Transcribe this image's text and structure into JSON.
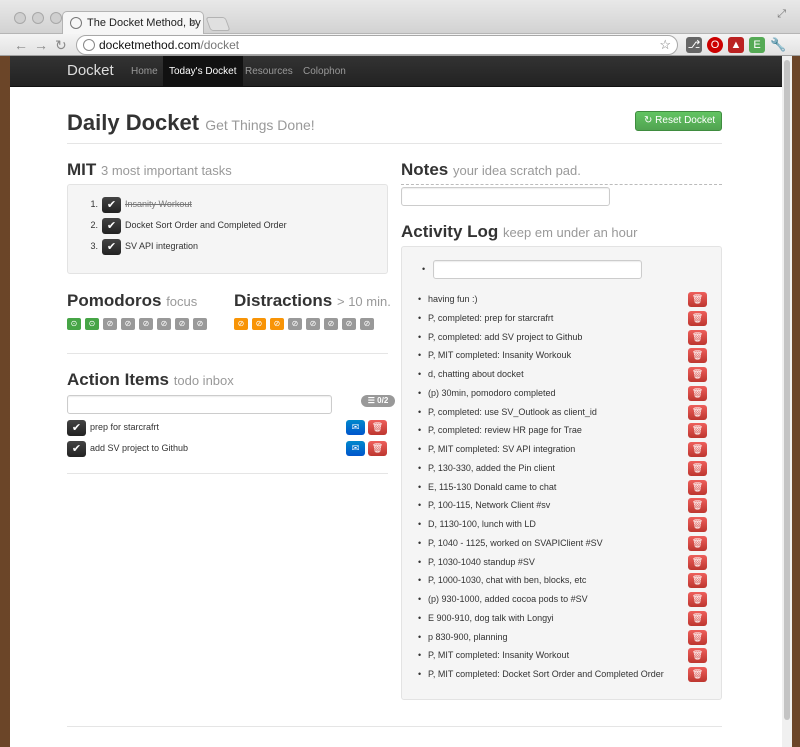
{
  "browser": {
    "tab_title": "The Docket Method, by Qtel",
    "url_host": "docketmethod.com",
    "url_path": "/docket"
  },
  "navbar": {
    "brand": "Docket",
    "links": [
      "Home",
      "Today's Docket",
      "Resources",
      "Colophon"
    ],
    "active_index": 1
  },
  "header": {
    "title": "Daily Docket",
    "subtitle": "Get Things Done!",
    "reset_button": "Reset Docket"
  },
  "mit": {
    "title": "MIT",
    "subtitle": "3 most important tasks",
    "items": [
      {
        "num": "1.",
        "label": "Insanity Workout",
        "done": true
      },
      {
        "num": "2.",
        "label": "Docket Sort Order and Completed Order",
        "done": false
      },
      {
        "num": "3.",
        "label": "SV API integration",
        "done": false
      }
    ]
  },
  "pomodoros": {
    "title": "Pomodoros",
    "subtitle": "focus",
    "total": 8,
    "completed": 2
  },
  "distractions": {
    "title": "Distractions",
    "subtitle": "> 10 min.",
    "total": 8,
    "completed": 3
  },
  "action_items": {
    "title": "Action Items",
    "subtitle": "todo inbox",
    "input_value": "",
    "count": "0/2",
    "items": [
      "prep for starcrafrt",
      "add SV project to Github"
    ]
  },
  "notes": {
    "title": "Notes",
    "subtitle": "your idea scratch pad.",
    "input_value": ""
  },
  "activity_log": {
    "title": "Activity Log",
    "subtitle": "keep em under an hour",
    "input_value": "",
    "entries": [
      "having fun :)",
      "P, completed: prep for starcrafrt",
      "P, completed: add SV project to Github",
      "P, MIT completed: Insanity Workouk",
      "d, chatting about docket",
      "(p) 30min, pomodoro completed",
      "P, completed: use SV_Outlook as client_id",
      "P, completed: review HR page for Trae",
      "P, MIT completed: SV API integration",
      "P, 130-330, added the Pin client",
      "E, 115-130 Donald came to chat",
      "P, 100-115, Network Client #sv",
      "D, 1130-100, lunch with LD",
      "P, 1040 - 1125, worked on SVAPIClient #SV",
      "P, 1030-1040 standup #SV",
      "P, 1000-1030, chat with ben, blocks, etc",
      "(p) 930-1000, added cocoa pods to #SV",
      "E 900-910, dog talk with Longyi",
      "p 830-900, planning",
      "P, MIT completed: Insanity Workout",
      "P, MIT completed: Docket Sort Order and Completed Order"
    ]
  },
  "colors": {
    "success": "#51a351",
    "danger": "#bd362f",
    "primary": "#0055cc",
    "warning": "#f89406"
  }
}
